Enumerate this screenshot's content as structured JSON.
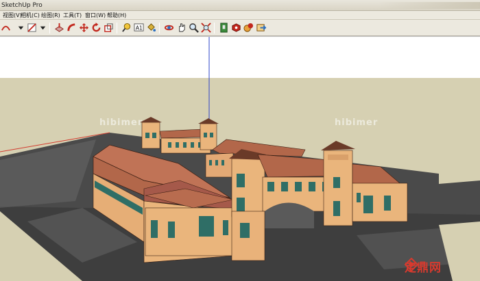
{
  "window": {
    "title": "SketchUp Pro"
  },
  "menu": {
    "items": [
      {
        "label": "视图(V)"
      },
      {
        "label": "相机(C)"
      },
      {
        "label": "绘图(R)"
      },
      {
        "label": "工具(T)"
      },
      {
        "label": "窗口(W)"
      },
      {
        "label": "帮助(H)"
      }
    ]
  },
  "toolbar": {
    "tools": [
      {
        "icon": "pencil-arc-icon"
      },
      {
        "icon": "eraser-shape-icon"
      },
      {
        "icon": "move-icon"
      },
      {
        "icon": "rotate-icon"
      },
      {
        "icon": "scale-icon"
      },
      {
        "icon": "tape-measure-icon"
      },
      {
        "icon": "text-label-icon"
      },
      {
        "icon": "paint-bucket-icon"
      },
      {
        "icon": "orbit-icon"
      },
      {
        "icon": "pan-icon"
      },
      {
        "icon": "zoom-icon"
      },
      {
        "icon": "zoom-extents-icon"
      },
      {
        "icon": "warehouse-icon"
      },
      {
        "icon": "get-models-icon"
      },
      {
        "icon": "share-model-icon"
      },
      {
        "icon": "extension-icon"
      }
    ],
    "text_tool_label": "A1"
  },
  "viewport": {
    "watermarks": [
      "hibimer",
      "hibimer"
    ],
    "site_logo": "定鼎网",
    "colors": {
      "sky": "#ffffff",
      "ground": "#d6d0b2",
      "roof": "#b2674a",
      "wall": "#eab57c",
      "window": "#2f6e66"
    }
  }
}
